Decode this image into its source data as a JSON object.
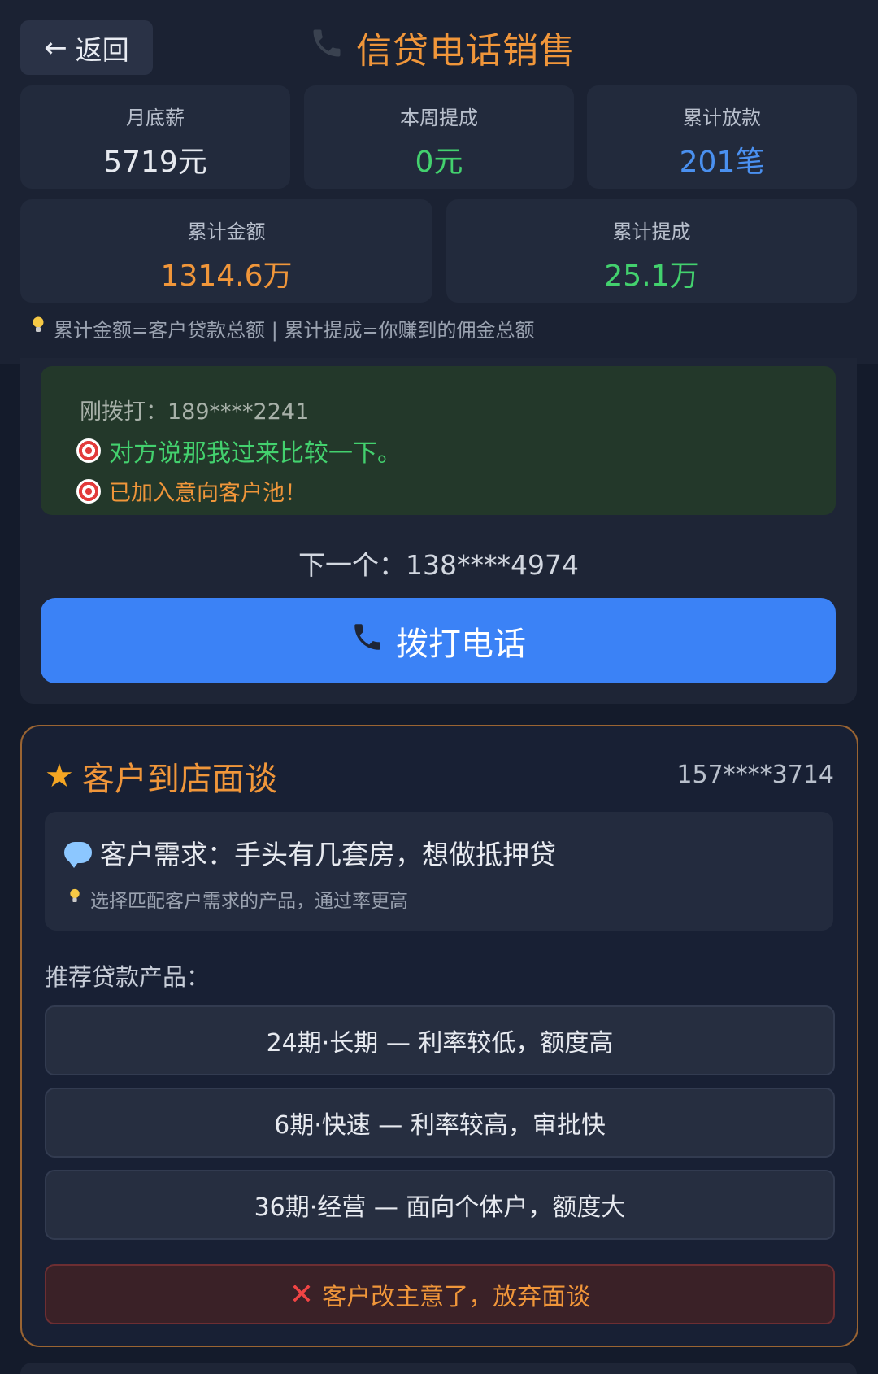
{
  "header": {
    "back_label": "返回",
    "title": "信贷电话销售"
  },
  "stats": [
    {
      "label": "月底薪",
      "value": "5719元",
      "color": "#e6e9ef"
    },
    {
      "label": "本周提成",
      "value": "0元",
      "color": "#43d16e"
    },
    {
      "label": "累计放款",
      "value": "201笔",
      "color": "#4a90f0"
    },
    {
      "label": "累计金额",
      "value": "1314.6万",
      "color": "#f0963a"
    },
    {
      "label": "累计提成",
      "value": "25.1万",
      "color": "#43d16e"
    }
  ],
  "hint": "累计金额=客户贷款总额 | 累计提成=你赚到的佣金总额",
  "call": {
    "last_dialed": "刚拨打：189****2241",
    "reply": "对方说那我过来比较一下。",
    "status": "已加入意向客户池！",
    "next": "下一个：138****4974",
    "dial_label": "拨打电话"
  },
  "interview": {
    "title": "客户到店面谈",
    "phone": "157****3714",
    "need": "客户需求：手头有几套房，想做抵押贷",
    "tip": "选择匹配客户需求的产品，通过率更高",
    "rec_label": "推荐贷款产品：",
    "products": [
      "24期·长期 — 利率较低，额度高",
      "6期·快速 — 利率较高，审批快",
      "36期·经营 — 面向个体户，额度大"
    ],
    "abandon_label": "客户改主意了，放弃面谈"
  }
}
